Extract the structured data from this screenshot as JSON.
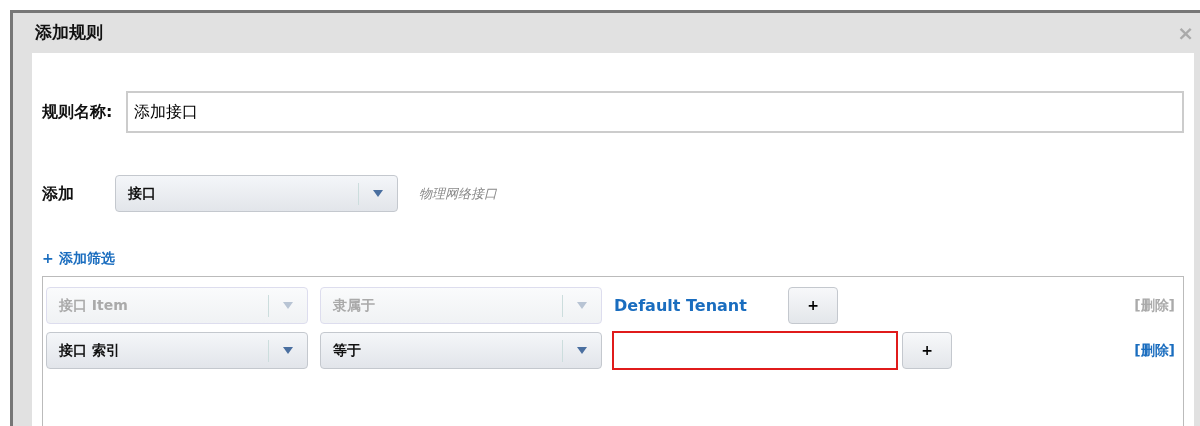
{
  "window": {
    "title": "添加规则",
    "close": "×"
  },
  "rule_name": {
    "label": "规则名称:",
    "value": "添加接口"
  },
  "add": {
    "label": "添加",
    "select": "接口",
    "hint": "物理网络接口"
  },
  "add_filter": "+ 添加筛选",
  "filters": [
    {
      "kind": "fixed",
      "disabled": true,
      "field": "接口 Item",
      "operator": "隶属于",
      "value": "Default Tenant",
      "plus": "+",
      "delete": "[删除]"
    },
    {
      "kind": "input",
      "disabled": false,
      "invalid": true,
      "field": "接口 索引",
      "operator": "等于",
      "plus": "+",
      "delete": "[删除]"
    }
  ]
}
